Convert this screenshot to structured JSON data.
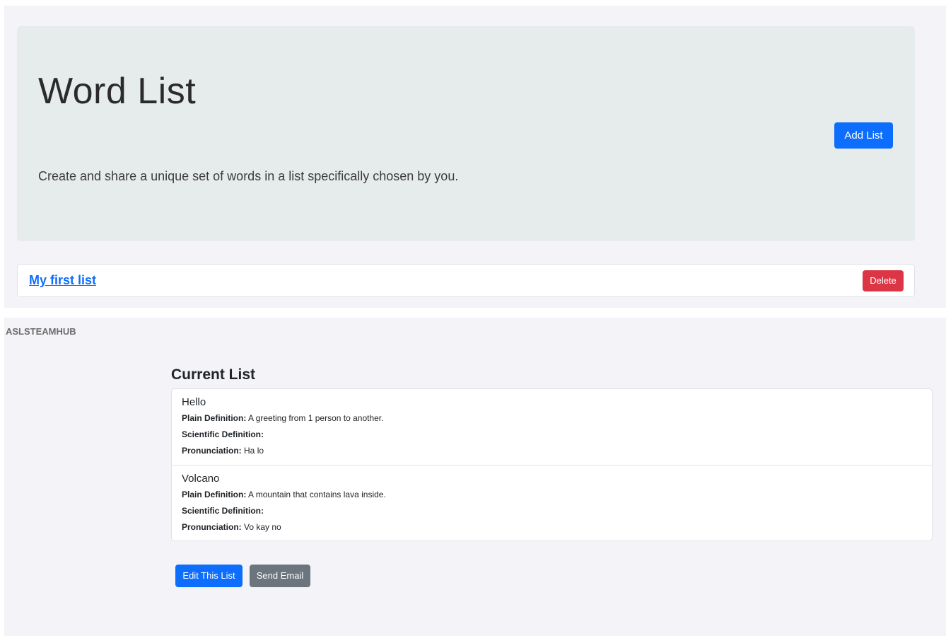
{
  "hero": {
    "title": "Word List",
    "lead": "Create and share a unique set of words in a list specifically chosen by you.",
    "add_button": "Add List"
  },
  "lists": [
    {
      "name": "My first list",
      "delete_label": "Delete"
    }
  ],
  "brand": "ASLSTEAMHUB",
  "current": {
    "heading": "Current List",
    "labels": {
      "plain": "Plain Definition:",
      "scientific": "Scientific Definition:",
      "pronunciation": "Pronunciation:"
    },
    "words": [
      {
        "word": "Hello",
        "plain": "A greeting from 1 person to another.",
        "scientific": "",
        "pronunciation": "Ha lo"
      },
      {
        "word": "Volcano",
        "plain": "A mountain that contains lava inside.",
        "scientific": "",
        "pronunciation": "Vo kay no"
      }
    ]
  },
  "actions": {
    "edit": "Edit This List",
    "email": "Send Email"
  },
  "colors": {
    "primary": "#0d6efd",
    "danger": "#dc3545",
    "secondary": "#6c757d",
    "hero_bg": "#e6ebeb",
    "panel_bg": "#f4f4f8"
  }
}
